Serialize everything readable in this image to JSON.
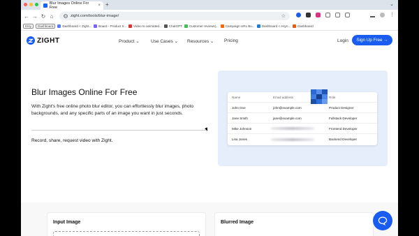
{
  "browser": {
    "tab_title": "Blur Images Online For Free",
    "tab_close": "×",
    "new_tab": "+",
    "tab_menu": "⌄",
    "url": "zight.com/tools/blur-image/",
    "nav": {
      "back": "←",
      "forward": "→",
      "reload": "↻",
      "home": "⌂"
    }
  },
  "bookmarks": [
    {
      "label": "Etsy",
      "type": "pill"
    },
    {
      "label": "Dashboard",
      "type": "pill"
    },
    {
      "label": "Dashboard < Zight...",
      "color": "#5c7cfa"
    },
    {
      "label": "Board - Product Ir...",
      "color": "#7b61ff"
    },
    {
      "label": "Video to animated...",
      "color": "#e03131"
    },
    {
      "label": "ChatGPT",
      "color": "#555555"
    },
    {
      "label": "Customer reviews|...",
      "color": "#40c057"
    },
    {
      "label": "Campaign URL Bu...",
      "color": "#f76707"
    },
    {
      "label": "Dashboard < Asyn...",
      "color": "#1c7ed6"
    },
    {
      "label": "Dashboard",
      "color": "#e8590c"
    }
  ],
  "site": {
    "logo": "ZIGHT",
    "nav": [
      {
        "label": "Product",
        "caret": "⌄"
      },
      {
        "label": "Use Cases",
        "caret": "⌄"
      },
      {
        "label": "Resources",
        "caret": "⌄"
      },
      {
        "label": "Pricing",
        "caret": ""
      }
    ],
    "login": "Login",
    "signup": "Sign Up Free →"
  },
  "hero": {
    "title": "Blur Images Online For Free",
    "description": "With Zight's free online photo blur editor, you can effortlessly blur images, photo backgrounds, and any specific parts of an image you want in just seconds.",
    "cta": "Record, share, request video with Zight."
  },
  "demo_table": {
    "headers": [
      "Name",
      "Email address",
      "Role"
    ],
    "rows": [
      {
        "name": "John Doe",
        "email": "john@example.com",
        "role": "Product Designer"
      },
      {
        "name": "Jane Smith",
        "email": "jane@example.com",
        "role": "Fullstack Developer"
      },
      {
        "name": "Mike Johnson",
        "email": "",
        "role": "Frontend Developer"
      },
      {
        "name": "Lisa Jones",
        "email": "",
        "role": "Backend Developer"
      }
    ]
  },
  "tool": {
    "input_title": "Input Image",
    "output_title": "Blurred Image"
  },
  "colors": {
    "brand": "#1a5cf0",
    "hero_bg": "#e6eefc"
  }
}
